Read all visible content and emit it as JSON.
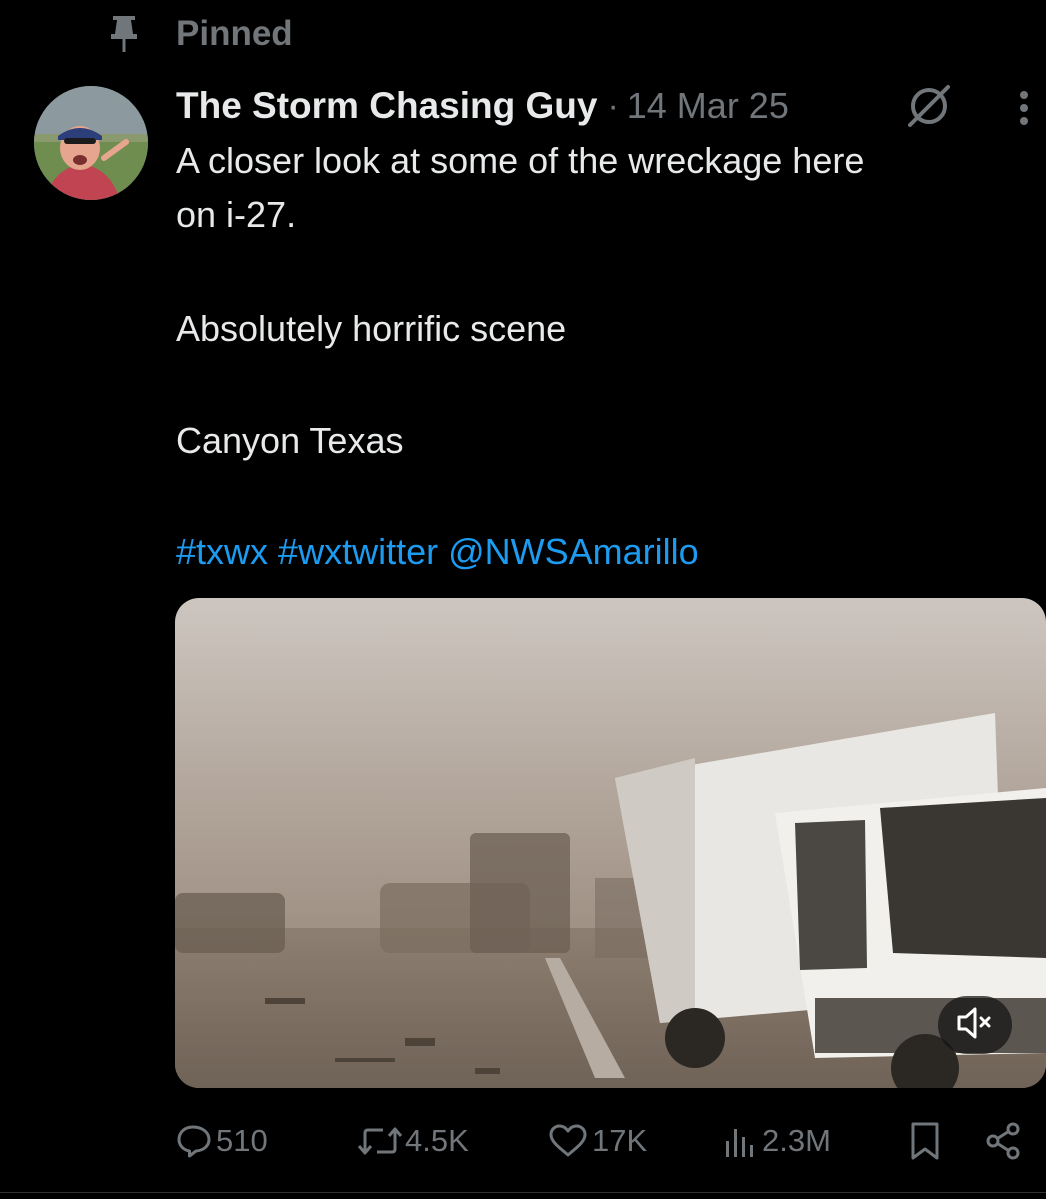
{
  "pinned": {
    "label": "Pinned",
    "icon": "pin-icon"
  },
  "tweet": {
    "author": "The Storm Chasing Guy",
    "separator": "·",
    "date": "14 Mar 25",
    "text_lines": [
      "A closer look at some of the wreckage here",
      "on i-27.",
      "Absolutely horrific scene",
      "Canyon Texas"
    ],
    "tags": [
      "#txwx",
      "#wxtwitter",
      "@NWSAmarillo"
    ]
  },
  "media": {
    "type": "video",
    "muted": true,
    "mute_icon": "speaker-muted-icon"
  },
  "actions": {
    "replies": "510",
    "reposts": "4.5K",
    "likes": "17K",
    "views": "2.3M"
  },
  "colors": {
    "background": "#000000",
    "text": "#e7e9ea",
    "secondary": "#71767b",
    "link": "#1d9bf0"
  }
}
